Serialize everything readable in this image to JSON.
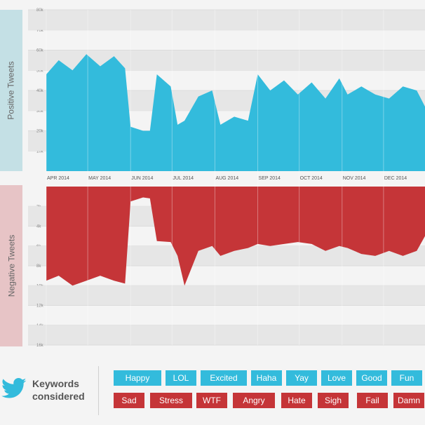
{
  "chart_data": [
    {
      "type": "area",
      "ylabel": "Positive Tweets",
      "yticks": [
        "10k",
        "20k",
        "30k",
        "40k",
        "50k",
        "60k",
        "70k",
        "80k"
      ],
      "ylim": [
        0,
        80000
      ],
      "months": [
        "APR 2014",
        "MAY 2014",
        "JUN 2014",
        "JUL 2014",
        "AUG 2014",
        "SEP 2014",
        "OCT 2014",
        "NOV 2014",
        "DEC 2014"
      ],
      "x": [
        "2014-04-01",
        "2014-04-10",
        "2014-04-20",
        "2014-04-30",
        "2014-05-10",
        "2014-05-20",
        "2014-05-28",
        "2014-06-01",
        "2014-06-10",
        "2014-06-15",
        "2014-06-20",
        "2014-06-30",
        "2014-07-05",
        "2014-07-10",
        "2014-07-20",
        "2014-07-30",
        "2014-08-05",
        "2014-08-15",
        "2014-08-25",
        "2014-09-01",
        "2014-09-10",
        "2014-09-20",
        "2014-09-30",
        "2014-10-10",
        "2014-10-20",
        "2014-10-30",
        "2014-11-05",
        "2014-11-15",
        "2014-11-25",
        "2014-12-05",
        "2014-12-15",
        "2014-12-25",
        "2014-12-31"
      ],
      "values": [
        48000,
        55000,
        50000,
        58000,
        52000,
        57000,
        51000,
        22000,
        20000,
        20000,
        48000,
        42000,
        23000,
        25000,
        37000,
        40000,
        23000,
        27000,
        25000,
        48000,
        40000,
        45000,
        38000,
        44000,
        36000,
        46000,
        38000,
        42000,
        38000,
        36000,
        42000,
        40000,
        32000
      ],
      "grid": true,
      "color": "#33bbdc"
    },
    {
      "type": "area",
      "ylabel": "Negative Tweets",
      "yticks": [
        "2k",
        "4k",
        "6k",
        "8k",
        "10k",
        "12k",
        "14k",
        "16k"
      ],
      "ylim": [
        0,
        16000
      ],
      "inverted": true,
      "x": [
        "2014-04-01",
        "2014-04-10",
        "2014-04-20",
        "2014-04-30",
        "2014-05-10",
        "2014-05-20",
        "2014-05-28",
        "2014-06-01",
        "2014-06-10",
        "2014-06-15",
        "2014-06-20",
        "2014-06-30",
        "2014-07-05",
        "2014-07-10",
        "2014-07-20",
        "2014-07-30",
        "2014-08-05",
        "2014-08-15",
        "2014-08-25",
        "2014-09-01",
        "2014-09-10",
        "2014-09-20",
        "2014-09-30",
        "2014-10-10",
        "2014-10-20",
        "2014-10-30",
        "2014-11-05",
        "2014-11-15",
        "2014-11-25",
        "2014-12-05",
        "2014-12-15",
        "2014-12-25",
        "2014-12-31"
      ],
      "values": [
        9500,
        9000,
        10000,
        9500,
        9000,
        9500,
        9800,
        1500,
        1100,
        1200,
        5500,
        5600,
        7000,
        10000,
        6500,
        6000,
        7000,
        6500,
        6200,
        5800,
        6000,
        5800,
        5600,
        5800,
        6500,
        6000,
        6200,
        6800,
        7000,
        6500,
        7000,
        6500,
        5000
      ],
      "grid": true,
      "color": "#c53538"
    }
  ],
  "keywords": {
    "title_line1": "Keywords",
    "title_line2": "considered",
    "positive": [
      "Happy",
      "LOL",
      "Excited",
      "Haha",
      "Yay",
      "Love",
      "Good",
      "Fun"
    ],
    "negative": [
      "Sad",
      "Stress",
      "WTF",
      "Angry",
      "Hate",
      "Sigh",
      "Fail",
      "Damn"
    ],
    "positive_color": "#33bbdc",
    "negative_color": "#c53538"
  },
  "icons": {
    "brand": "twitter-bird-icon"
  }
}
